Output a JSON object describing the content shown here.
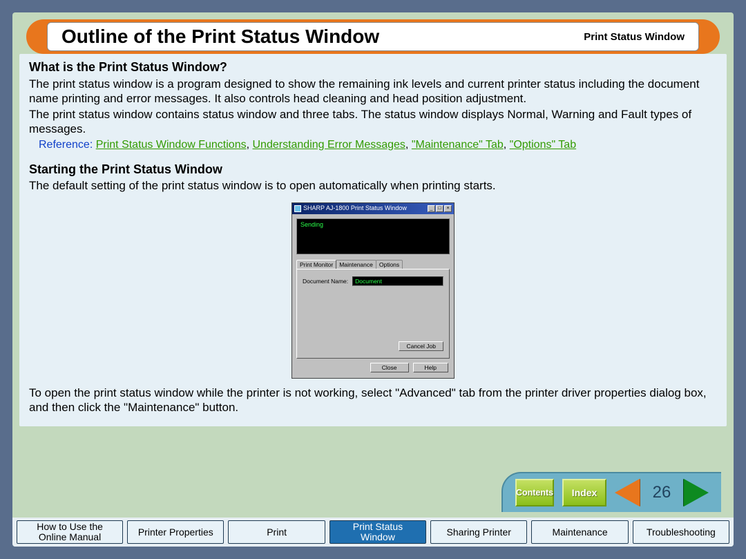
{
  "header": {
    "title": "Outline of the Print Status Window",
    "section_label": "Print Status Window"
  },
  "sections": {
    "s1_heading": "What is the Print Status Window?",
    "s1_p1": "The print status window is a program designed to show the remaining ink levels and current printer status including the document name printing and error messages. It also controls head cleaning and head position adjustment.",
    "s1_p2": "The print status window contains status window and three tabs. The status window displays Normal, Warning and Fault types of messages.",
    "ref_label": "Reference:",
    "ref_links": [
      "Print Status Window Functions",
      "Understanding Error Messages",
      "\"Maintenance\" Tab",
      "\"Options\" Tab"
    ],
    "s2_heading": "Starting the Print Status Window",
    "s2_p1": "The default setting of the print status window is to open automatically when printing starts.",
    "s2_p2": "To open the print status window while the printer is not working, select \"Advanced\" tab from the printer driver properties dialog box, and then click the \"Maintenance\" button."
  },
  "inner_window": {
    "title": "SHARP AJ-1800 Print Status Window",
    "status_text": "Sending",
    "tabs": [
      "Print Monitor",
      "Maintenance",
      "Options"
    ],
    "docname_label": "Document Name:",
    "docname_value": "Document",
    "cancel_btn": "Cancel Job",
    "close_btn": "Close",
    "help_btn": "Help"
  },
  "nav": {
    "contents": "Contents",
    "index": "Index",
    "page_number": "26"
  },
  "bottom_tabs": [
    {
      "line1": "How to Use the",
      "line2": "Online Manual"
    },
    {
      "line1": "Printer Properties",
      "line2": ""
    },
    {
      "line1": "Print",
      "line2": ""
    },
    {
      "line1": "Print Status",
      "line2": "Window"
    },
    {
      "line1": "Sharing Printer",
      "line2": ""
    },
    {
      "line1": "Maintenance",
      "line2": ""
    },
    {
      "line1": "Troubleshooting",
      "line2": ""
    }
  ]
}
